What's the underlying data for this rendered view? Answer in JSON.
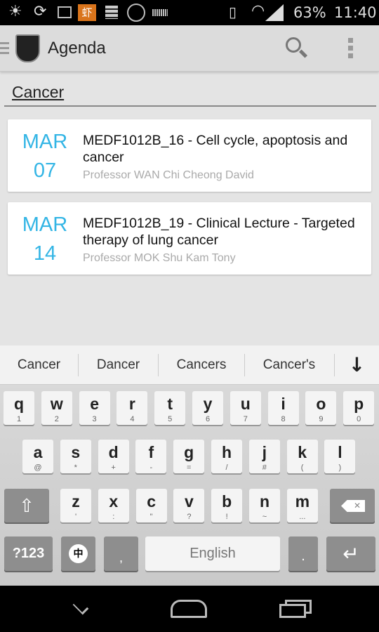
{
  "status": {
    "battery": "63%",
    "time": "11:40",
    "notif_icons": [
      "brightness-icon",
      "sync-icon",
      "image-icon",
      "shrimp-app-icon",
      "storage-icon",
      "curve-app-icon",
      "keyboard-icon"
    ]
  },
  "appbar": {
    "title": "Agenda"
  },
  "search": {
    "query": "Cancer"
  },
  "events": [
    {
      "month": "MAR",
      "day": "07",
      "title": "MEDF1012B_16 - Cell cycle, apoptosis and cancer",
      "professor": "Professor WAN Chi Cheong David"
    },
    {
      "month": "MAR",
      "day": "14",
      "title": "MEDF1012B_19 - Clinical Lecture - Targeted therapy of lung cancer",
      "professor": "Professor MOK Shu Kam Tony"
    }
  ],
  "keyboard": {
    "suggestions": [
      "Cancer",
      "Dancer",
      "Cancers",
      "Cancer's"
    ],
    "row1": [
      [
        "q",
        "1"
      ],
      [
        "w",
        "2"
      ],
      [
        "e",
        "3"
      ],
      [
        "r",
        "4"
      ],
      [
        "t",
        "5"
      ],
      [
        "y",
        "6"
      ],
      [
        "u",
        "7"
      ],
      [
        "i",
        "8"
      ],
      [
        "o",
        "9"
      ],
      [
        "p",
        "0"
      ]
    ],
    "row2": [
      [
        "a",
        "@"
      ],
      [
        "s",
        "*"
      ],
      [
        "d",
        "+"
      ],
      [
        "f",
        "-"
      ],
      [
        "g",
        "="
      ],
      [
        "h",
        "/"
      ],
      [
        "j",
        "#"
      ],
      [
        "k",
        "("
      ],
      [
        "l",
        ")"
      ]
    ],
    "row3": [
      [
        "z",
        "'"
      ],
      [
        "x",
        ":"
      ],
      [
        "c",
        "\""
      ],
      [
        "v",
        "?"
      ],
      [
        "b",
        "!"
      ],
      [
        "n",
        "~"
      ],
      [
        "m",
        "..."
      ]
    ],
    "symbols": "?123",
    "chinese": "中",
    "comma": ",",
    "space": "English",
    "period": "."
  }
}
